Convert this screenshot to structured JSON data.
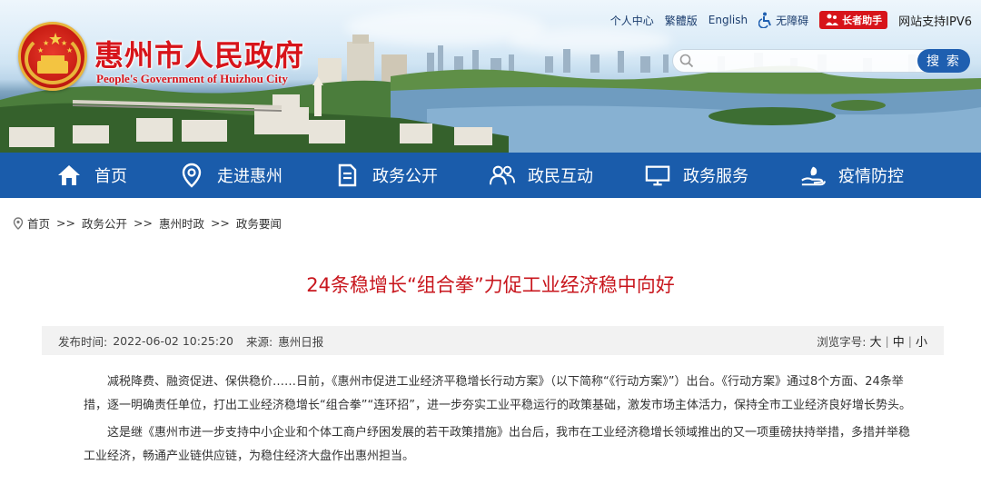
{
  "header": {
    "title": "惠州市人民政府",
    "subtitle": "People's Government of Huizhou City",
    "toplinks": {
      "personal": "个人中心",
      "traditional": "繁體版",
      "english": "English",
      "accessibility": "无障碍",
      "elder_helper": "长者助手",
      "ipv6": "网站支持IPV6"
    },
    "search": {
      "placeholder": "",
      "button": "搜 索"
    }
  },
  "nav": {
    "items": [
      {
        "label": "首页",
        "icon": "home-icon"
      },
      {
        "label": "走进惠州",
        "icon": "location-pin-icon"
      },
      {
        "label": "政务公开",
        "icon": "document-icon"
      },
      {
        "label": "政民互动",
        "icon": "people-icon"
      },
      {
        "label": "政务服务",
        "icon": "monitor-icon"
      },
      {
        "label": "疫情防控",
        "icon": "hand-care-icon"
      }
    ]
  },
  "breadcrumb": {
    "items": [
      "首页",
      "政务公开",
      "惠州时政",
      "政务要闻"
    ],
    "separator": ">>"
  },
  "article": {
    "title": "24条稳增长“组合拳”力促工业经济稳中向好",
    "publish_time_label": "发布时间:",
    "publish_time": "2022-06-02 10:25:20",
    "source_label": "来源:",
    "source": "惠州日报",
    "font_size_label": "浏览字号:",
    "font_sizes": [
      "大",
      "中",
      "小"
    ],
    "paragraphs": [
      "减税降费、融资促进、保供稳价……日前，《惠州市促进工业经济平稳增长行动方案》（以下简称“《行动方案》”）出台。《行动方案》通过8个方面、24条举措，逐一明确责任单位，打出工业经济稳增长“组合拳”“连环招”，进一步夯实工业平稳运行的政策基础，激发市场主体活力，保持全市工业经济良好增长势头。",
      "这是继《惠州市进一步支持中小企业和个体工商户纾困发展的若干政策措施》出台后，我市在工业经济稳增长领域推出的又一项重磅扶持举措，多措并举稳工业经济，畅通产业链供应链，为稳住经济大盘作出惠州担当。"
    ]
  },
  "colors": {
    "brand_red": "#d7141a",
    "nav_blue": "#1a5cab",
    "title_red": "#c8161d"
  }
}
